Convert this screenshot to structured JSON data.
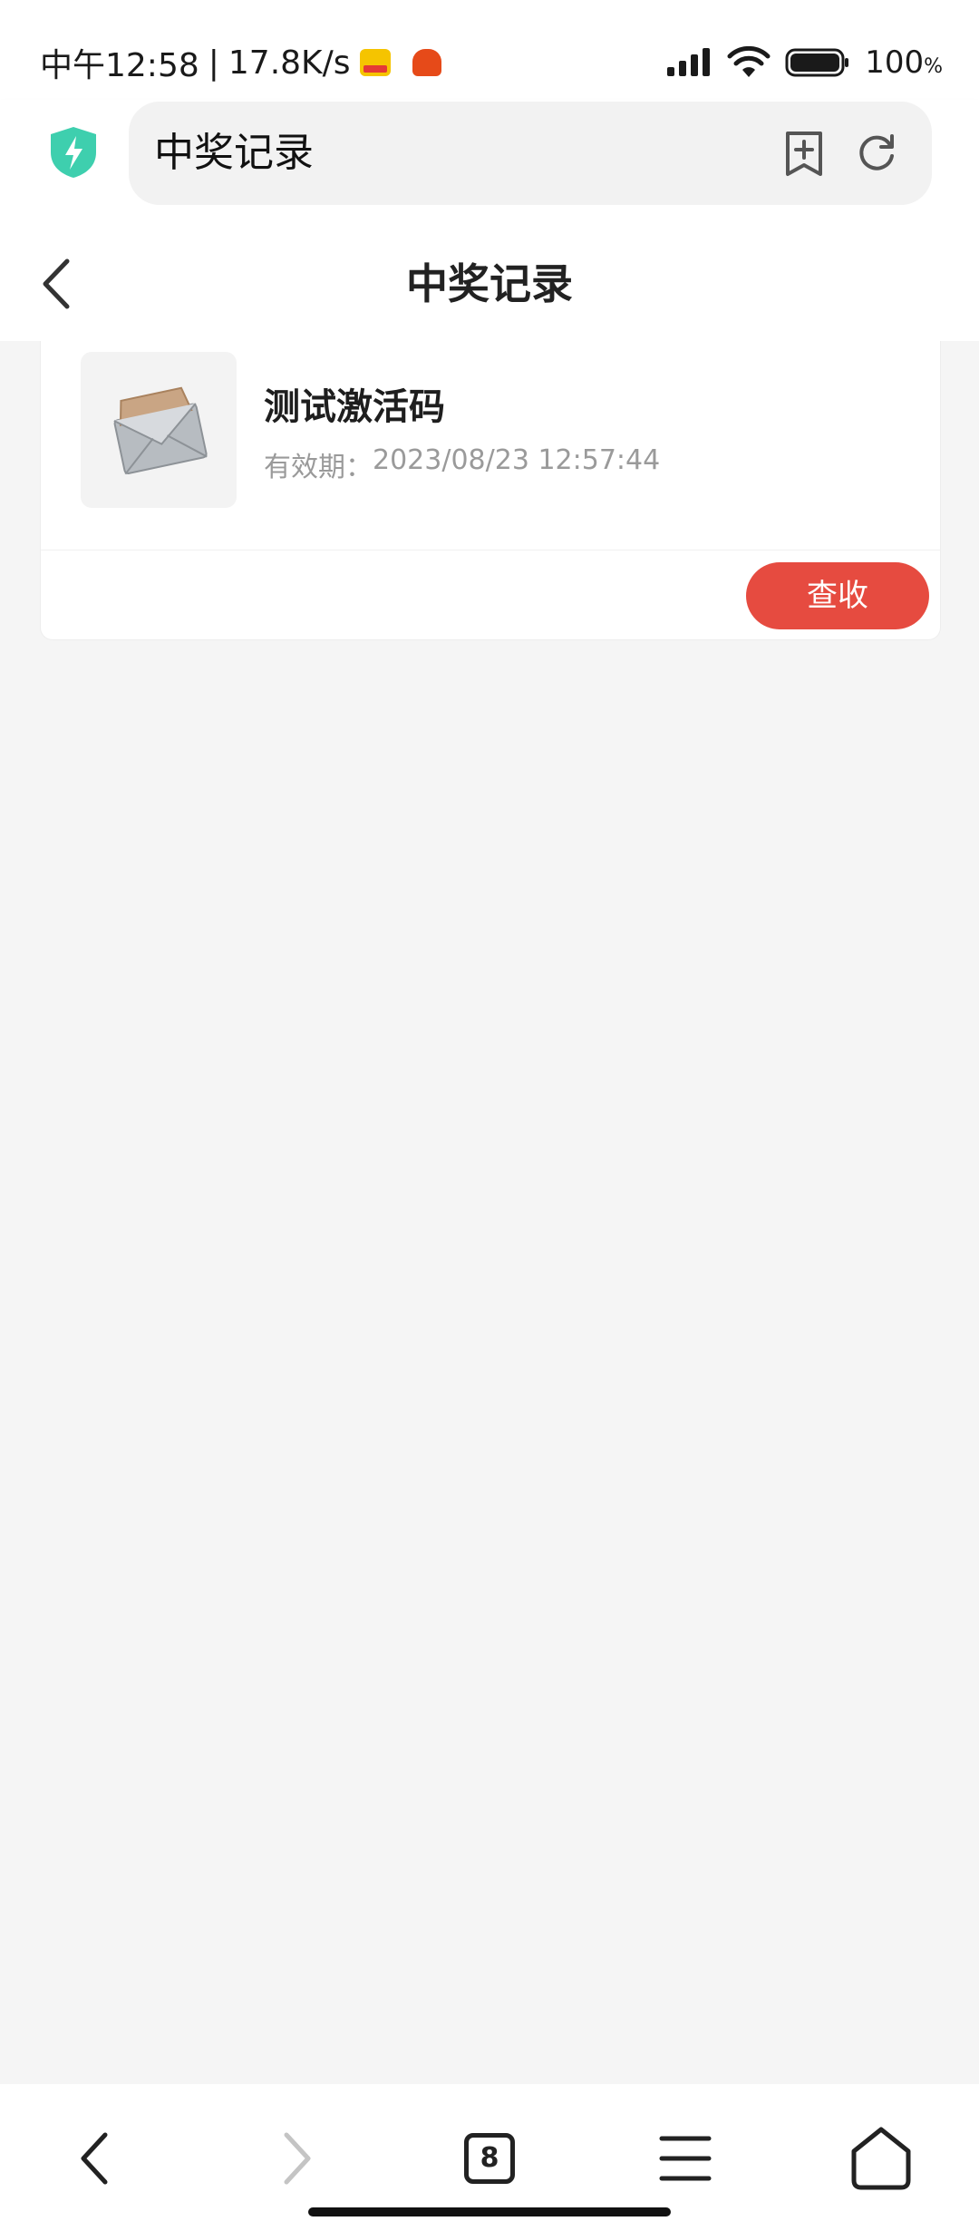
{
  "status_bar": {
    "time": "中午12:58",
    "separator": "|",
    "net_speed": "17.8K/s",
    "battery_pct": "100",
    "battery_unit": "%",
    "icons": [
      "app-notification-icon",
      "robot-app-icon",
      "signal-icon",
      "wifi-icon",
      "battery-icon"
    ]
  },
  "browser": {
    "address_title": "中奖记录",
    "icons": [
      "shield-icon",
      "bookmark-add-icon",
      "refresh-icon"
    ]
  },
  "header": {
    "title": "中奖记录"
  },
  "prize_records": [
    {
      "name": "测试激活码",
      "expiry_label": "有效期：",
      "expiry_value": "2023/08/23 12:57:44",
      "action_label": "查收",
      "thumbnail_icon": "envelope-icon"
    }
  ],
  "bottom_nav": {
    "tab_count": "8",
    "icons": [
      "back-icon",
      "forward-icon",
      "tabs-icon",
      "menu-icon",
      "home-icon"
    ]
  },
  "colors": {
    "accent": "#e64b40",
    "shield": "#3ecfae",
    "background": "#f5f5f5"
  }
}
